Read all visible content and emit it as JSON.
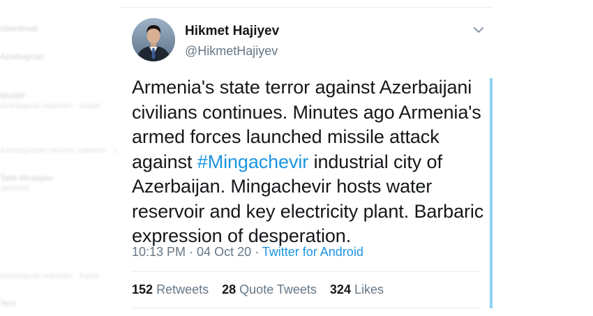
{
  "background_list": {
    "items": [
      {
        "label": "ödənilməli",
        "sub": ""
      },
      {
        "label": "Azərbaycan",
        "sub": ""
      },
      {
        "label": "Muxbir",
        "sub": "Azərbaycan xəbərləri · Sosial"
      },
      {
        "label": "",
        "sub": "Azərbaycanın mühüm xəbərləri · 1 "
      },
      {
        "label": "Talib Musayev",
        "sub": "Jurnalist"
      },
      {
        "label": "",
        "sub": "Azərbaycan xəbərləri · Xəbər"
      },
      {
        "label": "Yeni",
        "sub": ""
      }
    ]
  },
  "tweet": {
    "author": {
      "display_name": "Hikmet Hajiyev",
      "handle": "@HikmetHajiyev"
    },
    "text_before_hashtag": "Armenia's state terror against Azerbaijani civilians continues. Minutes ago Armenia's armed forces launched missile attack against ",
    "hashtag": "#Mingachevir",
    "text_after_hashtag": " industrial city of Azerbaijan. Mingachevir hosts water reservoir and key electricity plant. Barbaric expression of desperation.",
    "timestamp": "10:13 PM · 04 Oct 20 · ",
    "source": "Twitter for Android",
    "stats": {
      "retweets_count": "152",
      "retweets_label": "Retweets",
      "quotes_count": "28",
      "quotes_label": "Quote Tweets",
      "likes_count": "324",
      "likes_label": "Likes"
    }
  },
  "colors": {
    "link": "#1b95e0",
    "text": "#14171a",
    "secondary": "#657786",
    "thread_line": "#8fd1f1"
  },
  "icons": {
    "menu": "chevron-down-icon"
  }
}
